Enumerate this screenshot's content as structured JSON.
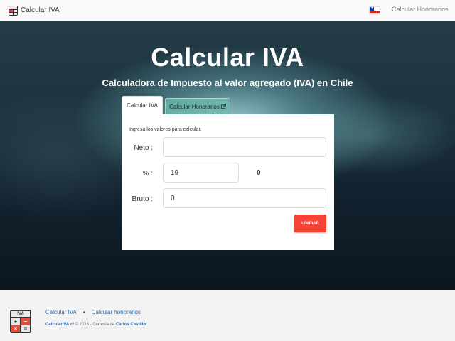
{
  "navbar": {
    "brand": "Calcular IVA",
    "brand_icon": "calculator-icon",
    "flag_icon": "chile-flag-icon",
    "link": "Calcular Honorarios"
  },
  "hero": {
    "title": "Calcular IVA",
    "subtitle": "Calculadora de Impuesto al valor agregado (IVA) en Chile"
  },
  "tabs": [
    {
      "label": "Calcular IVA",
      "active": true
    },
    {
      "label": "Calcular Honorarios",
      "active": false,
      "icon": "external-link-icon"
    }
  ],
  "form": {
    "hint": "Ingresa los valores para calcular.",
    "neto": {
      "label": "Neto :",
      "value": ""
    },
    "pct": {
      "label": "% :",
      "value": "19",
      "result": "0"
    },
    "bruto": {
      "label": "Bruto :",
      "value": "0"
    },
    "clear_button": "LIMPIAR"
  },
  "footer": {
    "link1": "Calcular IVA",
    "separator": "•",
    "link2": "Calcular honorarios",
    "site": "CalcularIVA.cl",
    "copy": " © 2016 - Cortesía de ",
    "author": "Carlos Castillo",
    "logo_label": "IVA"
  },
  "colors": {
    "accent_red": "#f44336",
    "link_blue": "#2a6db5",
    "tab_inactive": "#6ebeaf"
  }
}
